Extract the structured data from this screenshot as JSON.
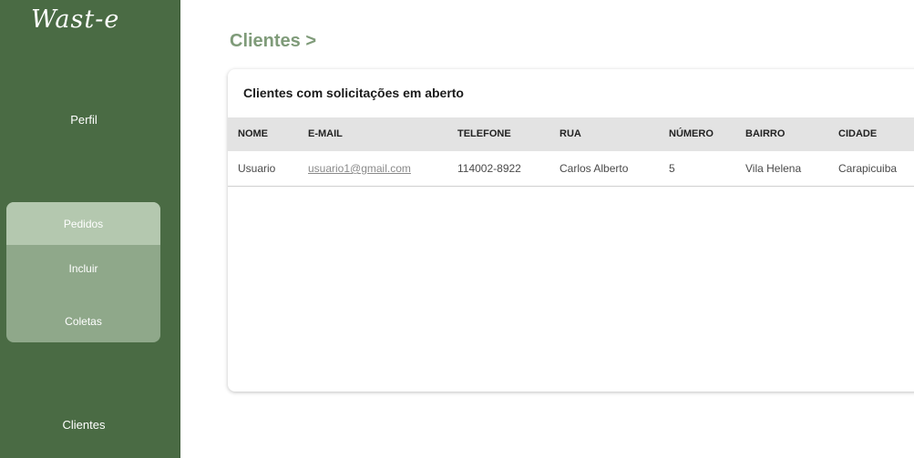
{
  "sidebar": {
    "logo": "Wast-e",
    "items": {
      "perfil": "Perfil",
      "pedidos": "Pedidos",
      "incluir": "Incluir",
      "coletas": "Coletas",
      "clientes": "Clientes"
    }
  },
  "page": {
    "title": "Clientes >"
  },
  "card": {
    "title": "Clientes com solicitações em aberto"
  },
  "table": {
    "headers": [
      "NOME",
      "E-MAIL",
      "TELEFONE",
      "RUA",
      "NÚMERO",
      "BAIRRO",
      "CIDADE"
    ],
    "rows": [
      [
        "Usuario",
        "usuario1@gmail.com",
        "114002-8922",
        "Carlos Alberto",
        "5",
        "Vila Helena",
        "Carapicuiba"
      ]
    ]
  },
  "colors": {
    "sidebar_bg": "#4a6b44",
    "submenu_bg": "#8fa88a",
    "submenu_active_bg": "#b4c8af",
    "title_color": "#7f9b79",
    "table_header_bg": "#e3e3e3"
  }
}
